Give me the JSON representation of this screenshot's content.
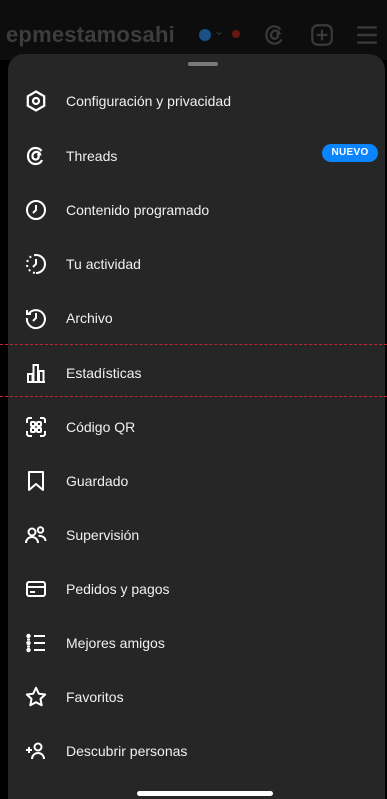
{
  "header": {
    "username": "epmestamosahi",
    "icons": [
      "verified-badge-icon",
      "chevron-down-icon",
      "threads-icon",
      "add-post-icon",
      "menu-icon"
    ]
  },
  "menu": {
    "items": [
      {
        "label": "Configuración y privacidad",
        "icon": "gear-icon"
      },
      {
        "label": "Threads",
        "icon": "threads-icon",
        "badge": "NUEVO"
      },
      {
        "label": "Contenido programado",
        "icon": "clock-icon"
      },
      {
        "label": "Tu actividad",
        "icon": "activity-icon"
      },
      {
        "label": "Archivo",
        "icon": "archive-icon"
      },
      {
        "label": "Estadísticas",
        "icon": "bar-chart-icon",
        "highlighted": true
      },
      {
        "label": "Código QR",
        "icon": "qr-code-icon"
      },
      {
        "label": "Guardado",
        "icon": "bookmark-icon"
      },
      {
        "label": "Supervisión",
        "icon": "supervision-icon"
      },
      {
        "label": "Pedidos y pagos",
        "icon": "card-icon"
      },
      {
        "label": "Mejores amigos",
        "icon": "close-friends-icon"
      },
      {
        "label": "Favoritos",
        "icon": "star-icon"
      },
      {
        "label": "Descubrir personas",
        "icon": "add-person-icon"
      }
    ]
  },
  "colors": {
    "background": "#000000",
    "sheet": "#262626",
    "badge": "#0a84ff",
    "highlight_border": "#c0262d"
  }
}
